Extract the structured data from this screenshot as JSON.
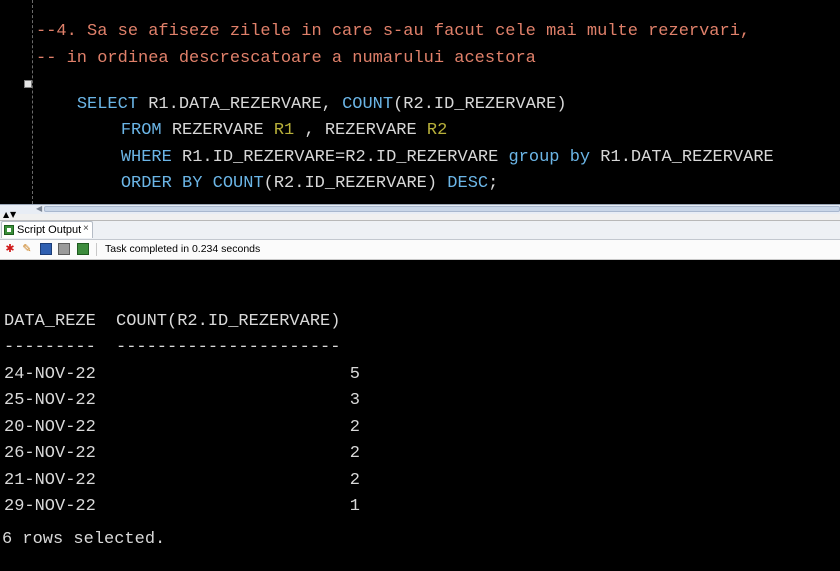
{
  "editor": {
    "comment_line_1": "--4. Sa se afiseze zilele in care s-au facut cele mai multe rezervari,",
    "comment_line_2": "-- in ordinea descrescatoare a numarului acestora",
    "line3": {
      "kw1": "SELECT",
      "id1": " R1.DATA_REZERVARE, ",
      "kw2": "COUNT",
      "id2": "(R2.ID_REZERVARE)"
    },
    "line4": {
      "kw1": "FROM",
      "id1": " REZERVARE ",
      "al1": "R1",
      "id2": " , REZERVARE ",
      "al2": "R2"
    },
    "line5": {
      "kw1": "WHERE",
      "id1": " R1.ID_REZERVARE=R2.ID_REZERVARE ",
      "kw2": "group by",
      "id2": " R1.DATA_REZERVARE"
    },
    "line6": {
      "kw1": "ORDER BY",
      "id1": " ",
      "kw2": "COUNT",
      "id2": "(R2.ID_REZERVARE) ",
      "kw3": "DESC",
      "id3": ";"
    }
  },
  "output_panel": {
    "tab_label": "Script Output",
    "tab_close": "×",
    "status": "Task completed in 0.234 seconds",
    "toolbar_icons": [
      "pin-icon",
      "eraser-icon",
      "save-icon",
      "print-icon",
      "save-as-icon"
    ]
  },
  "result": {
    "header_date": "DATA_REZE",
    "header_count": "COUNT(R2.ID_REZERVARE)",
    "underline_date": "---------",
    "underline_count": "----------------------",
    "rows": [
      {
        "date": "24-NOV-22",
        "count": "5"
      },
      {
        "date": "25-NOV-22",
        "count": "3"
      },
      {
        "date": "20-NOV-22",
        "count": "2"
      },
      {
        "date": "26-NOV-22",
        "count": "2"
      },
      {
        "date": "21-NOV-22",
        "count": "2"
      },
      {
        "date": "29-NOV-22",
        "count": "1"
      }
    ],
    "footer": "6 rows selected."
  },
  "colors": {
    "comment": "#e0806a",
    "keyword": "#6bb5e6",
    "alias": "#b8b03a",
    "text": "#d7d7d7"
  }
}
